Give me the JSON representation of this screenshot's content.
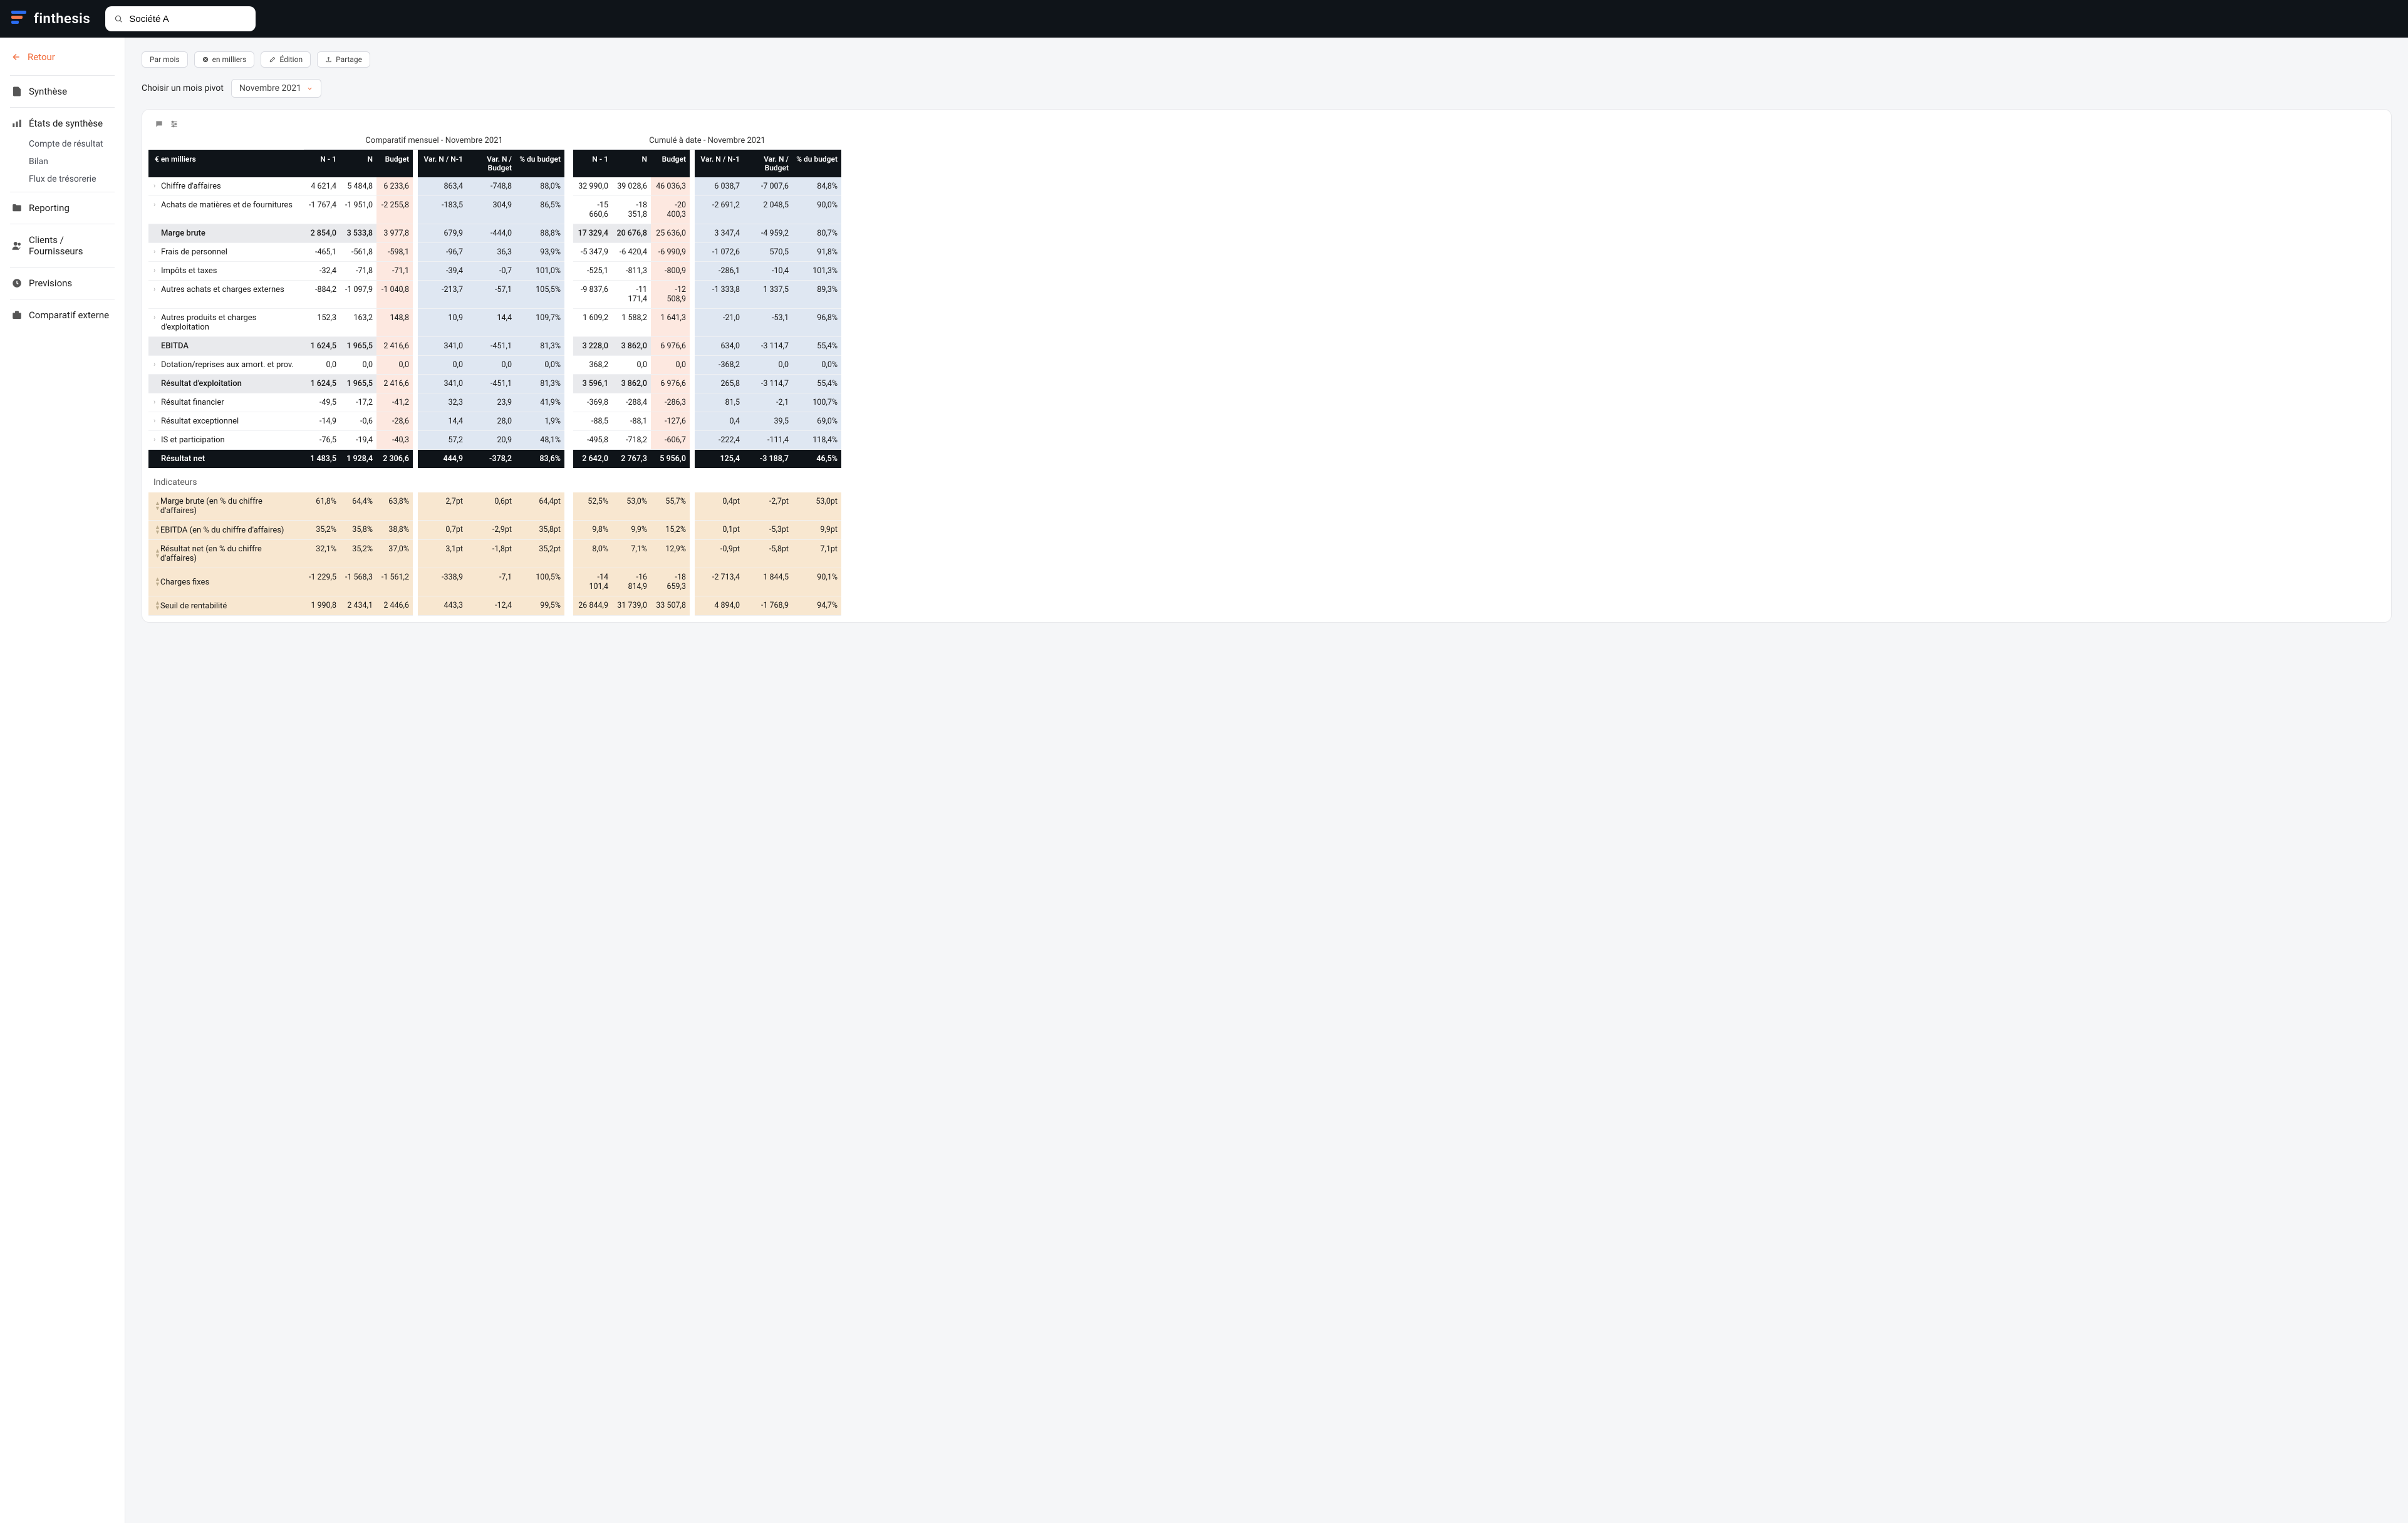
{
  "brand": "finthesis",
  "search": {
    "value": "Société A",
    "placeholder": ""
  },
  "sidebar": {
    "back": "Retour",
    "items": [
      {
        "label": "Synthèse"
      },
      {
        "label": "États de synthèse",
        "children": [
          "Compte de résultat",
          "Bilan",
          "Flux de trésorerie"
        ]
      },
      {
        "label": "Reporting"
      },
      {
        "label": "Clients / Fournisseurs"
      },
      {
        "label": "Previsions"
      },
      {
        "label": "Comparatif externe"
      }
    ]
  },
  "toolbar": {
    "par_mois": "Par mois",
    "en_milliers": "en milliers",
    "edition": "Édition",
    "partage": "Partage"
  },
  "pivot": {
    "label": "Choisir un mois pivot",
    "value": "Novembre 2021"
  },
  "sections": {
    "monthly": "Comparatif mensuel - Novembre 2021",
    "ytd": "Cumulé à date - Novembre 2021"
  },
  "columns": {
    "unit": "€ en milliers",
    "n1": "N - 1",
    "n": "N",
    "budget": "Budget",
    "var_n1": "Var. N / N-1",
    "var_bud": "Var. N / Budget",
    "pct_bud": "% du budget"
  },
  "indicators_header": "Indicateurs",
  "rows": [
    {
      "label": "Chiffre d'affaires",
      "exp": true,
      "style": "",
      "m": {
        "n1": "4 621,4",
        "n": "5 484,8",
        "b": "6 233,6",
        "v1": "863,4",
        "v2": "-748,8",
        "p": "88,0%"
      },
      "y": {
        "n1": "32 990,0",
        "n": "39 028,6",
        "b": "46 036,3",
        "v1": "6 038,7",
        "v2": "-7 007,6",
        "p": "84,8%"
      }
    },
    {
      "label": "Achats de matières et de fournitures",
      "exp": true,
      "style": "",
      "m": {
        "n1": "-1 767,4",
        "n": "-1 951,0",
        "b": "-2 255,8",
        "v1": "-183,5",
        "v2": "304,9",
        "p": "86,5%"
      },
      "y": {
        "n1": "-15 660,6",
        "n": "-18 351,8",
        "b": "-20 400,3",
        "v1": "-2 691,2",
        "v2": "2 048,5",
        "p": "90,0%"
      }
    },
    {
      "label": "Marge brute",
      "style": "sub",
      "m": {
        "n1": "2 854,0",
        "n": "3 533,8",
        "b": "3 977,8",
        "v1": "679,9",
        "v2": "-444,0",
        "p": "88,8%"
      },
      "y": {
        "n1": "17 329,4",
        "n": "20 676,8",
        "b": "25 636,0",
        "v1": "3 347,4",
        "v2": "-4 959,2",
        "p": "80,7%"
      }
    },
    {
      "label": "Frais de personnel",
      "exp": true,
      "style": "",
      "m": {
        "n1": "-465,1",
        "n": "-561,8",
        "b": "-598,1",
        "v1": "-96,7",
        "v2": "36,3",
        "p": "93,9%"
      },
      "y": {
        "n1": "-5 347,9",
        "n": "-6 420,4",
        "b": "-6 990,9",
        "v1": "-1 072,6",
        "v2": "570,5",
        "p": "91,8%"
      }
    },
    {
      "label": "Impôts et taxes",
      "exp": true,
      "style": "",
      "m": {
        "n1": "-32,4",
        "n": "-71,8",
        "b": "-71,1",
        "v1": "-39,4",
        "v2": "-0,7",
        "p": "101,0%"
      },
      "y": {
        "n1": "-525,1",
        "n": "-811,3",
        "b": "-800,9",
        "v1": "-286,1",
        "v2": "-10,4",
        "p": "101,3%"
      }
    },
    {
      "label": "Autres achats et charges externes",
      "exp": true,
      "style": "",
      "m": {
        "n1": "-884,2",
        "n": "-1 097,9",
        "b": "-1 040,8",
        "v1": "-213,7",
        "v2": "-57,1",
        "p": "105,5%"
      },
      "y": {
        "n1": "-9 837,6",
        "n": "-11 171,4",
        "b": "-12 508,9",
        "v1": "-1 333,8",
        "v2": "1 337,5",
        "p": "89,3%"
      }
    },
    {
      "label": "Autres produits et charges d'exploitation",
      "exp": true,
      "style": "",
      "m": {
        "n1": "152,3",
        "n": "163,2",
        "b": "148,8",
        "v1": "10,9",
        "v2": "14,4",
        "p": "109,7%"
      },
      "y": {
        "n1": "1 609,2",
        "n": "1 588,2",
        "b": "1 641,3",
        "v1": "-21,0",
        "v2": "-53,1",
        "p": "96,8%"
      }
    },
    {
      "label": "EBITDA",
      "style": "sub",
      "m": {
        "n1": "1 624,5",
        "n": "1 965,5",
        "b": "2 416,6",
        "v1": "341,0",
        "v2": "-451,1",
        "p": "81,3%"
      },
      "y": {
        "n1": "3 228,0",
        "n": "3 862,0",
        "b": "6 976,6",
        "v1": "634,0",
        "v2": "-3 114,7",
        "p": "55,4%"
      }
    },
    {
      "label": "Dotation/reprises aux amort. et prov.",
      "exp": true,
      "style": "",
      "m": {
        "n1": "0,0",
        "n": "0,0",
        "b": "0,0",
        "v1": "0,0",
        "v2": "0,0",
        "p": "0,0%"
      },
      "y": {
        "n1": "368,2",
        "n": "0,0",
        "b": "0,0",
        "v1": "-368,2",
        "v2": "0,0",
        "p": "0,0%"
      }
    },
    {
      "label": "Résultat d'exploitation",
      "style": "sub",
      "m": {
        "n1": "1 624,5",
        "n": "1 965,5",
        "b": "2 416,6",
        "v1": "341,0",
        "v2": "-451,1",
        "p": "81,3%"
      },
      "y": {
        "n1": "3 596,1",
        "n": "3 862,0",
        "b": "6 976,6",
        "v1": "265,8",
        "v2": "-3 114,7",
        "p": "55,4%"
      }
    },
    {
      "label": "Résultat financier",
      "exp": true,
      "style": "",
      "m": {
        "n1": "-49,5",
        "n": "-17,2",
        "b": "-41,2",
        "v1": "32,3",
        "v2": "23,9",
        "p": "41,9%"
      },
      "y": {
        "n1": "-369,8",
        "n": "-288,4",
        "b": "-286,3",
        "v1": "81,5",
        "v2": "-2,1",
        "p": "100,7%"
      }
    },
    {
      "label": "Résultat exceptionnel",
      "exp": true,
      "style": "",
      "m": {
        "n1": "-14,9",
        "n": "-0,6",
        "b": "-28,6",
        "v1": "14,4",
        "v2": "28,0",
        "p": "1,9%"
      },
      "y": {
        "n1": "-88,5",
        "n": "-88,1",
        "b": "-127,6",
        "v1": "0,4",
        "v2": "39,5",
        "p": "69,0%"
      }
    },
    {
      "label": "IS et participation",
      "exp": true,
      "style": "",
      "m": {
        "n1": "-76,5",
        "n": "-19,4",
        "b": "-40,3",
        "v1": "57,2",
        "v2": "20,9",
        "p": "48,1%"
      },
      "y": {
        "n1": "-495,8",
        "n": "-718,2",
        "b": "-606,7",
        "v1": "-222,4",
        "v2": "-111,4",
        "p": "118,4%"
      }
    },
    {
      "label": "Résultat net",
      "style": "total",
      "m": {
        "n1": "1 483,5",
        "n": "1 928,4",
        "b": "2 306,6",
        "v1": "444,9",
        "v2": "-378,2",
        "p": "83,6%"
      },
      "y": {
        "n1": "2 642,0",
        "n": "2 767,3",
        "b": "5 956,0",
        "v1": "125,4",
        "v2": "-3 188,7",
        "p": "46,5%"
      }
    }
  ],
  "indicators": [
    {
      "label": "Marge brute (en % du chiffre d'affaires)",
      "m": {
        "n1": "61,8%",
        "n": "64,4%",
        "b": "63,8%",
        "v1": "2,7pt",
        "v2": "0,6pt",
        "p": "64,4pt"
      },
      "y": {
        "n1": "52,5%",
        "n": "53,0%",
        "b": "55,7%",
        "v1": "0,4pt",
        "v2": "-2,7pt",
        "p": "53,0pt"
      }
    },
    {
      "label": "EBITDA (en % du chiffre d'affaires)",
      "m": {
        "n1": "35,2%",
        "n": "35,8%",
        "b": "38,8%",
        "v1": "0,7pt",
        "v2": "-2,9pt",
        "p": "35,8pt"
      },
      "y": {
        "n1": "9,8%",
        "n": "9,9%",
        "b": "15,2%",
        "v1": "0,1pt",
        "v2": "-5,3pt",
        "p": "9,9pt"
      }
    },
    {
      "label": "Résultat net (en % du chiffre d'affaires)",
      "m": {
        "n1": "32,1%",
        "n": "35,2%",
        "b": "37,0%",
        "v1": "3,1pt",
        "v2": "-1,8pt",
        "p": "35,2pt"
      },
      "y": {
        "n1": "8,0%",
        "n": "7,1%",
        "b": "12,9%",
        "v1": "-0,9pt",
        "v2": "-5,8pt",
        "p": "7,1pt"
      }
    },
    {
      "label": "Charges fixes",
      "m": {
        "n1": "-1 229,5",
        "n": "-1 568,3",
        "b": "-1 561,2",
        "v1": "-338,9",
        "v2": "-7,1",
        "p": "100,5%"
      },
      "y": {
        "n1": "-14 101,4",
        "n": "-16 814,9",
        "b": "-18 659,3",
        "v1": "-2 713,4",
        "v2": "1 844,5",
        "p": "90,1%"
      }
    },
    {
      "label": "Seuil de rentabilité",
      "m": {
        "n1": "1 990,8",
        "n": "2 434,1",
        "b": "2 446,6",
        "v1": "443,3",
        "v2": "-12,4",
        "p": "99,5%"
      },
      "y": {
        "n1": "26 844,9",
        "n": "31 739,0",
        "b": "33 507,8",
        "v1": "4 894,0",
        "v2": "-1 768,9",
        "p": "94,7%"
      }
    }
  ]
}
